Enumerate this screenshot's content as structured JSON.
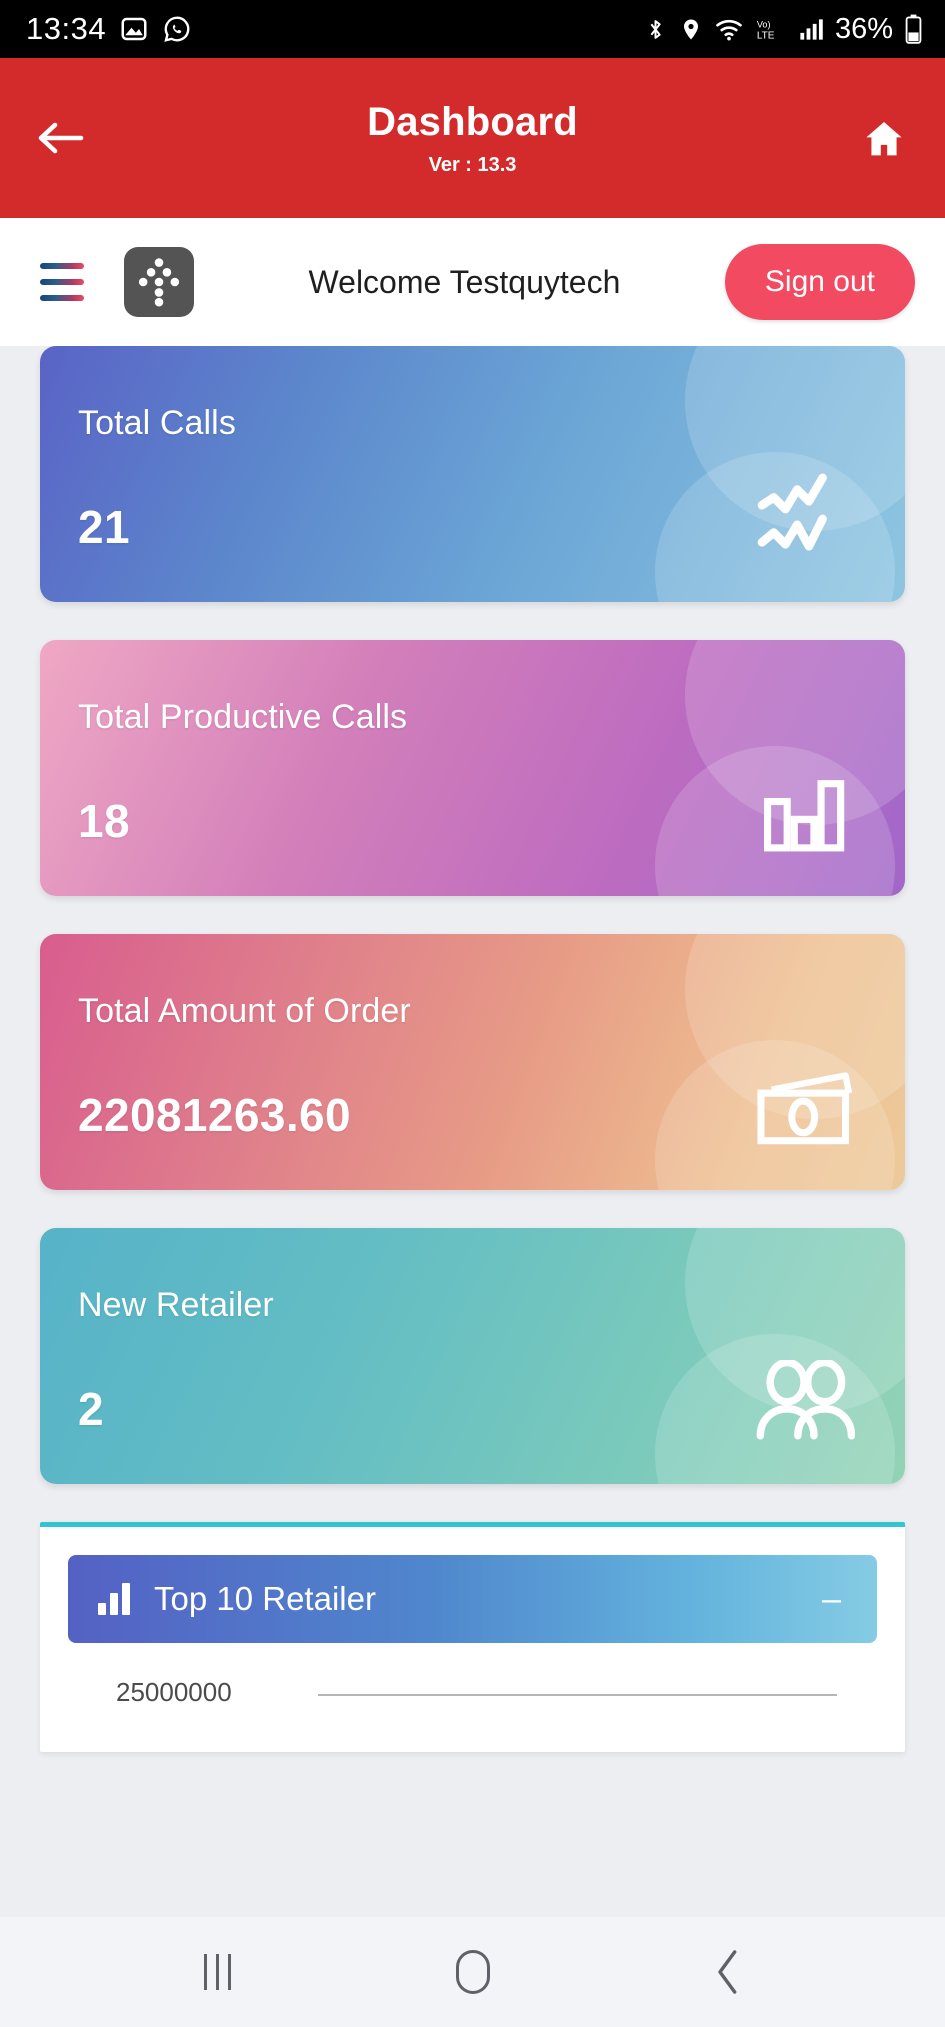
{
  "status_bar": {
    "time": "13:34",
    "left_icons": [
      "photos-icon",
      "whatsapp-icon"
    ],
    "right_icons": [
      "bluetooth-icon",
      "location-icon",
      "wifi-icon",
      "volte-icon",
      "signal-icon"
    ],
    "volte_label": "VoLTE",
    "battery_percent": "36%"
  },
  "app_bar": {
    "title": "Dashboard",
    "version": "Ver : 13.3",
    "back_icon": "arrow-left-icon",
    "home_icon": "home-icon"
  },
  "welcome_bar": {
    "menu_icon": "hamburger-menu-icon",
    "grid_icon": "network-grid-icon",
    "welcome_text": "Welcome Testquytech",
    "sign_out_label": "Sign out",
    "sign_out_color": "#f24a60"
  },
  "cards": [
    {
      "label": "Total Calls",
      "value": "21",
      "icon": "zigzag-trend-icon",
      "gradient_from": "#5a63c6",
      "gradient_to": "#8ec6e1"
    },
    {
      "label": "Total Productive Calls",
      "value": "18",
      "icon": "bar-chart-icon",
      "gradient_from": "#efa8c4",
      "gradient_to": "#a267c9"
    },
    {
      "label": "Total Amount of Order",
      "value": "22081263.60",
      "icon": "banknote-icon",
      "gradient_from": "#d85d8e",
      "gradient_to": "#edc99a"
    },
    {
      "label": "New Retailer",
      "value": "2",
      "icon": "two-people-icon",
      "gradient_from": "#56b3c8",
      "gradient_to": "#93d3b6"
    }
  ],
  "panel": {
    "title": "Top 10 Retailer",
    "icon": "bar-chart-icon",
    "collapse_label": "–",
    "accent_color": "#31c6cf"
  },
  "chart_data": {
    "type": "bar",
    "title": "Top 10 Retailer",
    "categories": [],
    "values": [],
    "xlabel": "",
    "ylabel": "",
    "ytick_labels": [
      "25000000"
    ],
    "ylim": [
      0,
      25000000
    ],
    "grid": true,
    "legend": "none",
    "note": "Chart body cut off below the visible viewport; only the topmost y-axis tick 25000000 and its gridline are rendered."
  },
  "nav_bar": {
    "recents_icon": "recents-icon",
    "home_icon": "home-circle-icon",
    "back_icon": "back-chevron-icon"
  }
}
